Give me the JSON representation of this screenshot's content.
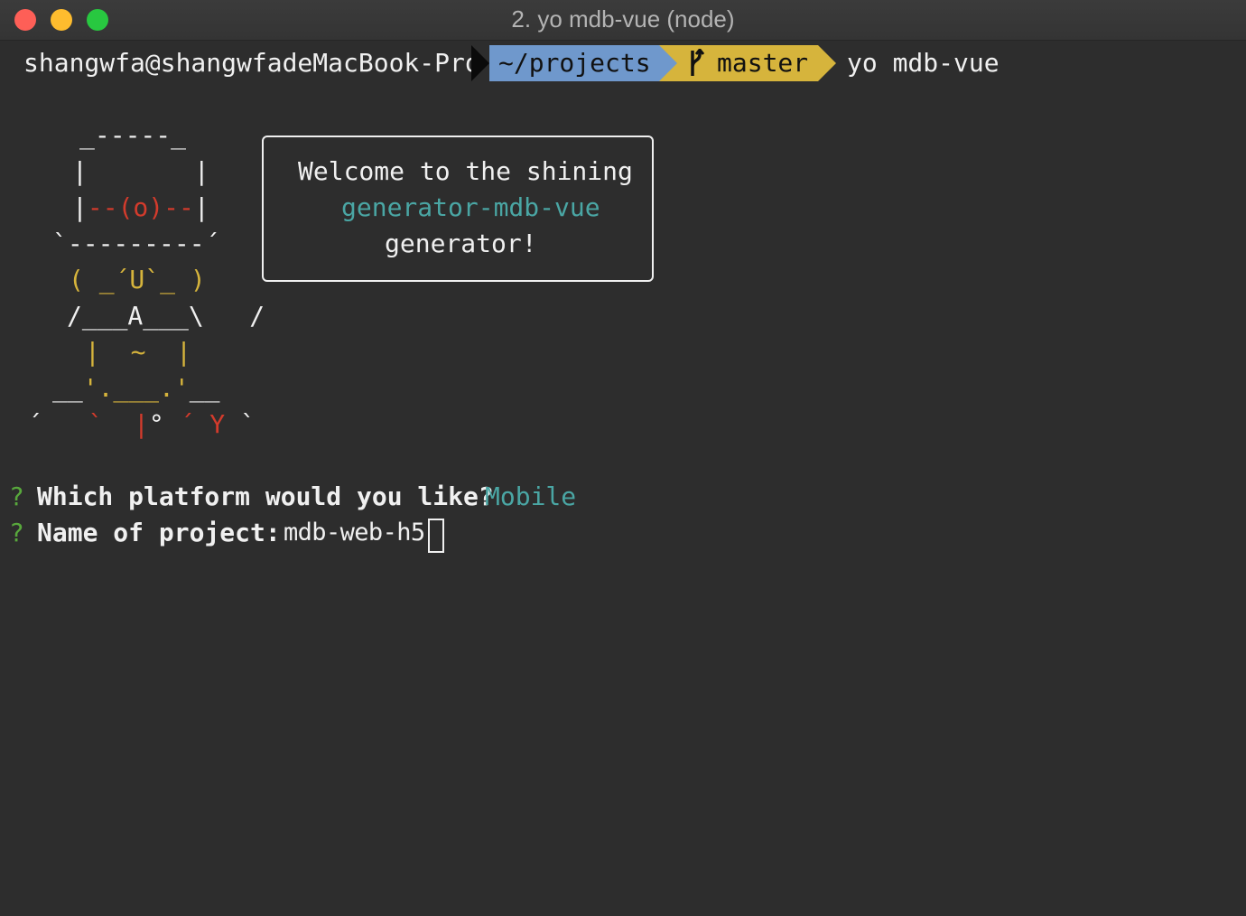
{
  "window": {
    "title": "2. yo mdb-vue (node)",
    "colors": {
      "close": "#fe5f57",
      "minimize": "#febc2e",
      "maximize": "#28c840"
    }
  },
  "prompt": {
    "user_host": "shangwfa@shangwfadeMacBook-Pro",
    "path": "~/projects",
    "branch_icon": "git-branch-icon",
    "branch": "master",
    "command": "yo mdb-vue",
    "colors": {
      "path_bg": "#6f98cc",
      "branch_bg": "#d6b43c"
    }
  },
  "yeoman": {
    "lines": [
      [
        {
          "t": "_-----_",
          "c": "w"
        }
      ],
      [
        {
          "t": "|       |",
          "c": "w"
        }
      ],
      [
        {
          "t": "|",
          "c": "w"
        },
        {
          "t": "--(o)--",
          "c": "r"
        },
        {
          "t": "|",
          "c": "w"
        }
      ],
      [
        {
          "t": "`---------´",
          "c": "w"
        }
      ],
      [
        {
          "t": "( _´U`_ )",
          "c": "y"
        }
      ],
      [
        {
          "t": "/___A___\\   /",
          "c": "w"
        }
      ],
      [
        {
          "t": "|  ~  |",
          "c": "y"
        }
      ],
      [
        {
          "t": "__",
          "c": "w"
        },
        {
          "t": "'.___.'",
          "c": "y"
        },
        {
          "t": "__",
          "c": "w"
        }
      ],
      [
        {
          "t": "´   ",
          "c": "w"
        },
        {
          "t": "`  |",
          "c": "r"
        },
        {
          "t": "° ",
          "c": "w"
        },
        {
          "t": "´ Y",
          "c": "r"
        },
        {
          "t": " `",
          "c": "w"
        }
      ]
    ],
    "bubble": {
      "line1": "Welcome to the shining",
      "line2": "generator-mdb-vue",
      "line3": "generator!"
    }
  },
  "questions": [
    {
      "mark": "?",
      "question": "Which platform would you like?",
      "answer": "Mobile"
    },
    {
      "mark": "?",
      "question": "Name of project:",
      "answer": "mdb-web-h5"
    }
  ]
}
